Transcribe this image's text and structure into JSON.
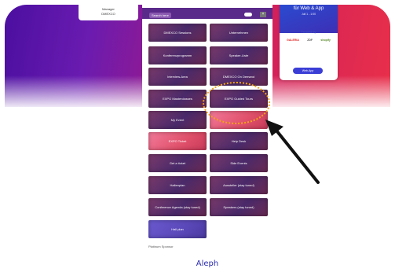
{
  "left_card": {
    "line1": "Manager",
    "line2": "DMEXCO"
  },
  "right_card": {
    "title": "für Web & App",
    "subtitle": "Juli 1 - 1:00",
    "trusted_by": "Trusted by",
    "logos": [
      "GALERIA",
      "ZDF",
      "shopify"
    ],
    "button": "Web-App"
  },
  "phone": {
    "search_label": "Search here",
    "close_label": "×",
    "tiles": [
      {
        "label": "DMEXCO Sessions",
        "style": "dark"
      },
      {
        "label": "Unternehmen",
        "style": "dark"
      },
      {
        "label": "Konferenzprogramm",
        "style": "dark"
      },
      {
        "label": "Speaker-Liste",
        "style": "dark"
      },
      {
        "label": "Interview-Area",
        "style": "dark"
      },
      {
        "label": "DMEXCO On Demand",
        "style": "dark"
      },
      {
        "label": "EXPO Masterclasses",
        "style": "dark"
      },
      {
        "label": "EXPO Guided Tours",
        "style": "dark"
      },
      {
        "label": "My Event",
        "style": "dark"
      },
      {
        "label": "",
        "style": "pink"
      },
      {
        "label": "EXPO Ticket",
        "style": "pink"
      },
      {
        "label": "Help Desk",
        "style": "dark"
      },
      {
        "label": "Get a ticket",
        "style": "dark"
      },
      {
        "label": "Side Events",
        "style": "dark"
      },
      {
        "label": "Hallenplan",
        "style": "dark"
      },
      {
        "label": "Aussteller (stay tuned)",
        "style": "dark"
      },
      {
        "label": "Conference Agenda (stay tuned)",
        "style": "dark"
      },
      {
        "label": "Speakers (stay tuned)",
        "style": "dark"
      },
      {
        "label": "Hall plan",
        "style": "purple"
      }
    ],
    "sponsor_label": "Platinum Sponsor",
    "sponsor_logo": "Aleph"
  },
  "colors": {
    "highlight": "#f2a31a",
    "arrow": "#111111",
    "hero_start": "#4b0fa0",
    "hero_end": "#e8304a"
  }
}
